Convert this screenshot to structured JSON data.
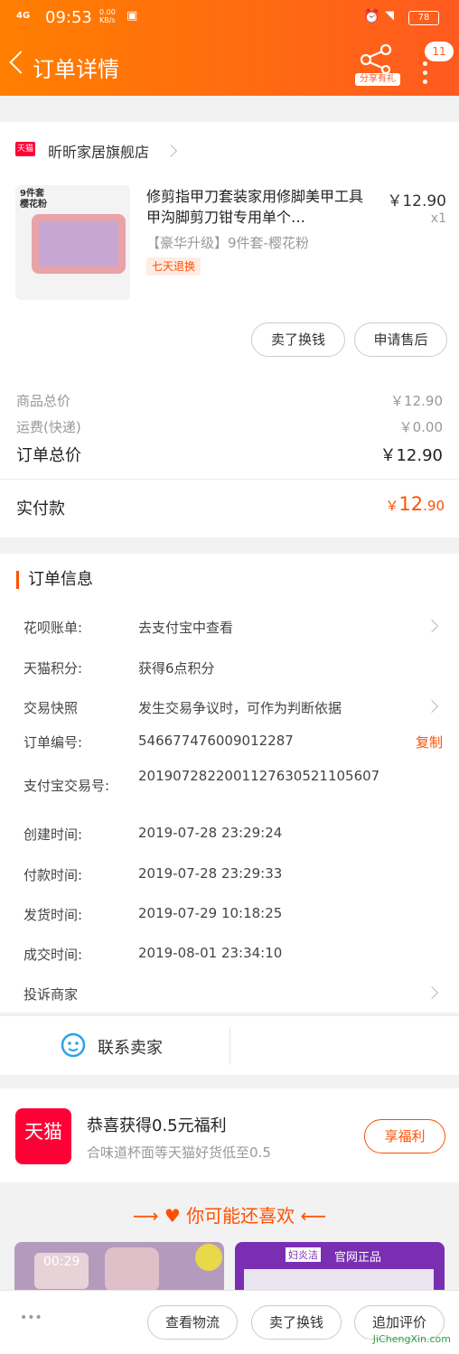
{
  "status": {
    "time": "09:53",
    "signal": "4G",
    "net_speed": "0.00\nKB/s",
    "battery": "78"
  },
  "header": {
    "title": "订单详情",
    "share_label": "分享有礼",
    "badge": "11"
  },
  "store": {
    "tag": "天猫",
    "name": "昕昕家居旗舰店"
  },
  "product": {
    "thumb_text": "9件套\n樱花粉",
    "name": "修剪指甲刀套装家用修脚美甲工具甲沟脚剪刀钳专用单个…",
    "price": "￥12.90",
    "qty": "x1",
    "sku": "【豪华升级】9件套-樱花粉",
    "tag": "七天退换",
    "btn_resell": "卖了换钱",
    "btn_aftersale": "申请售后"
  },
  "summary": {
    "goods_label": "商品总价",
    "goods_val": "￥12.90",
    "ship_label": "运费(快递)",
    "ship_val": "￥0.00",
    "total_label": "订单总价",
    "total_val": "￥12.90",
    "paid_label": "实付款",
    "paid_yen": "￥",
    "paid_int": "12",
    "paid_dec": ".90"
  },
  "info": {
    "title": "订单信息",
    "rows": [
      {
        "label": "花呗账单:",
        "value": "去支付宝中查看"
      },
      {
        "label": "天猫积分:",
        "value": "获得6点积分"
      },
      {
        "label": "交易快照",
        "value": "发生交易争议时，可作为判断依据"
      },
      {
        "label": "订单编号:",
        "value": "546677476009012287"
      },
      {
        "label": "支付宝交易号:",
        "value": "2019072822001127630521105607"
      },
      {
        "label": "创建时间:",
        "value": "2019-07-28 23:29:24"
      },
      {
        "label": "付款时间:",
        "value": "2019-07-28 23:29:33"
      },
      {
        "label": "发货时间:",
        "value": "2019-07-29 10:18:25"
      },
      {
        "label": "成交时间:",
        "value": "2019-08-01 23:34:10"
      },
      {
        "label": "投诉商家",
        "value": ""
      }
    ],
    "copy_label": "复制"
  },
  "contact": {
    "label": "联系卖家"
  },
  "promo": {
    "logo_text": "天猫",
    "title": "恭喜获得0.5元福利",
    "subtitle": "合味道杯面等天猫好货低至0.5",
    "button": "享福利"
  },
  "reco": {
    "title": "你可能还喜欢",
    "video_time": "00:29",
    "tile2_brand": "妇炎洁",
    "tile2_tag": "官网正品"
  },
  "bottom": {
    "more": "•••",
    "btn_logistics": "查看物流",
    "btn_resell": "卖了换钱",
    "btn_review": "追加评价"
  },
  "watermark": {
    "text": "JiChengXin.com"
  },
  "colors": {
    "accent": "#ff5000",
    "header_start": "#ff7f00",
    "header_end": "#ff5a1f",
    "tmall": "#ff0036"
  }
}
